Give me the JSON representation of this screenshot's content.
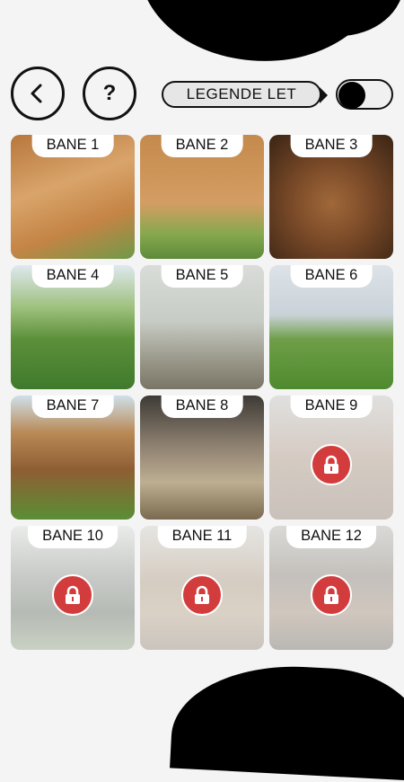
{
  "header": {
    "back_icon": "chevron-left-icon",
    "help_label": "?",
    "legend_label": "LEGENDE LET",
    "toggle_state": "off"
  },
  "levels": [
    {
      "label": "BANE 1",
      "locked": false,
      "photo": "p1"
    },
    {
      "label": "BANE 2",
      "locked": false,
      "photo": "p2"
    },
    {
      "label": "BANE 3",
      "locked": false,
      "photo": "p3"
    },
    {
      "label": "BANE 4",
      "locked": false,
      "photo": "p4"
    },
    {
      "label": "BANE 5",
      "locked": false,
      "photo": "p5"
    },
    {
      "label": "BANE 6",
      "locked": false,
      "photo": "p6"
    },
    {
      "label": "BANE 7",
      "locked": false,
      "photo": "p7"
    },
    {
      "label": "BANE 8",
      "locked": false,
      "photo": "p8"
    },
    {
      "label": "BANE 9",
      "locked": true,
      "photo": "p9"
    },
    {
      "label": "BANE 10",
      "locked": true,
      "photo": "p10"
    },
    {
      "label": "BANE 11",
      "locked": true,
      "photo": "p11"
    },
    {
      "label": "BANE 12",
      "locked": true,
      "photo": "p12"
    }
  ],
  "colors": {
    "lock_badge": "#d33c3c",
    "background": "#f4f4f4",
    "outline": "#111111"
  }
}
